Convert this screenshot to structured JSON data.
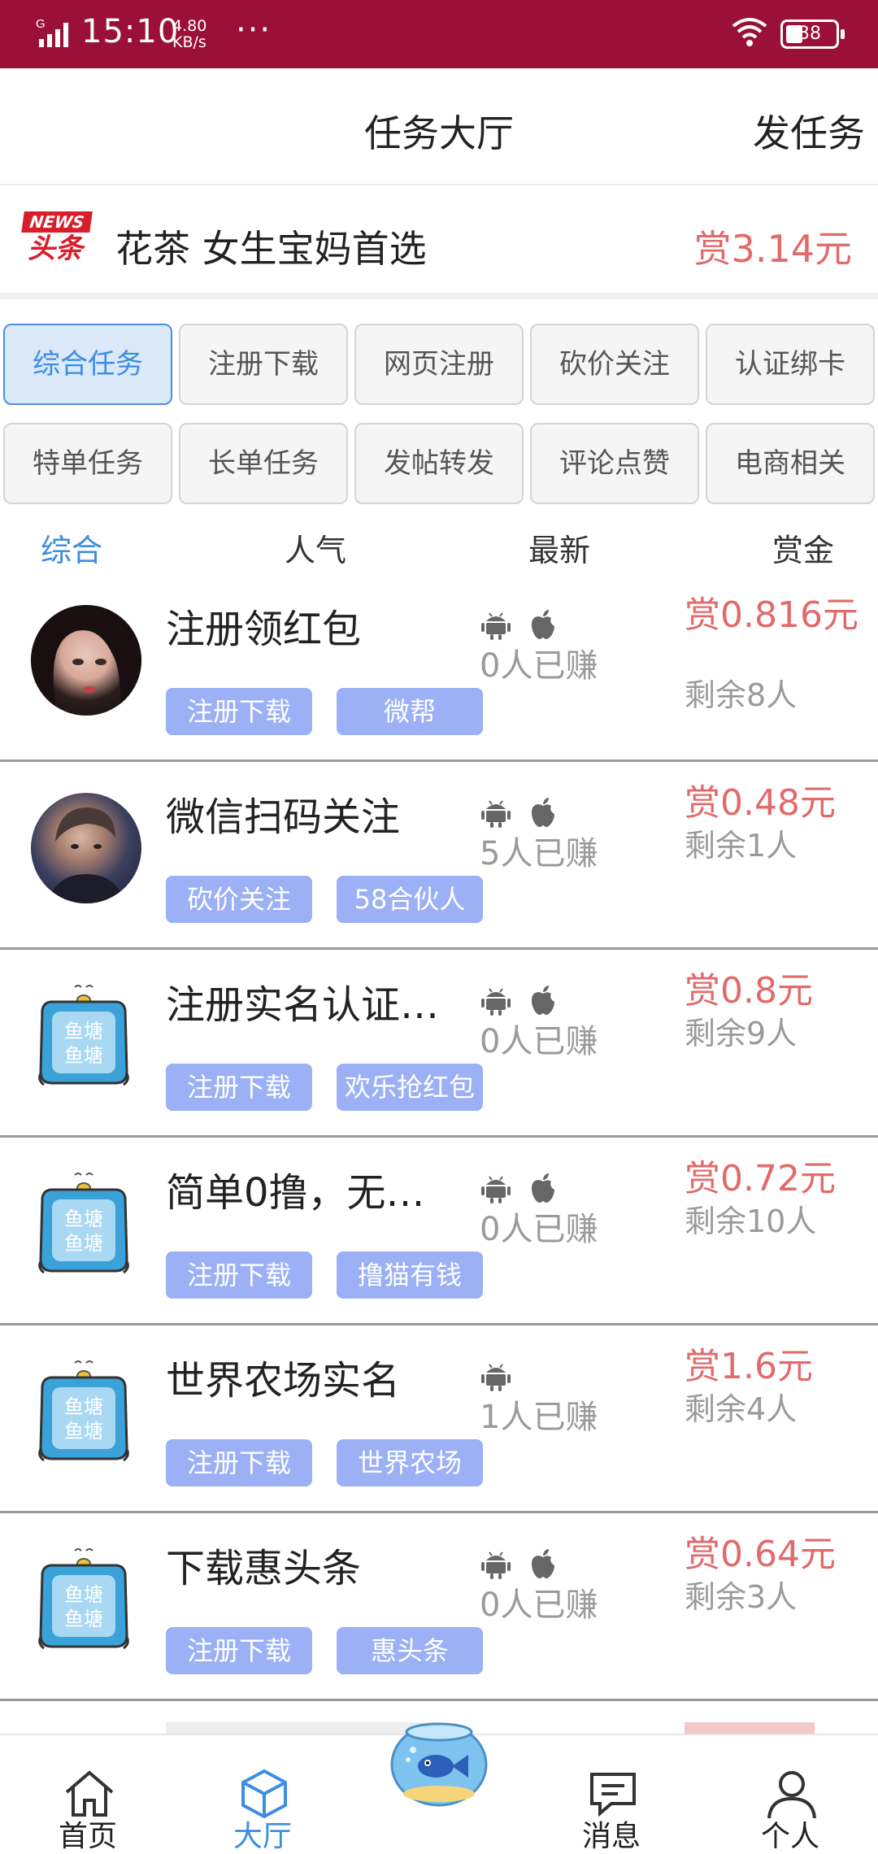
{
  "status_bar": {
    "signal": "G",
    "time": "15:10",
    "speed_value": "4.80",
    "speed_unit": "KB/s",
    "more": "···",
    "battery": "38"
  },
  "header": {
    "title": "任务大厅",
    "action": "发任务"
  },
  "banner": {
    "logo_en": "NEWS",
    "logo_cn": "头条",
    "text": "花茶 女生宝妈首选",
    "reward": "赏3.14元"
  },
  "categories": [
    "综合任务",
    "注册下载",
    "网页注册",
    "砍价关注",
    "认证绑卡",
    "特单任务",
    "长单任务",
    "发帖转发",
    "评论点赞",
    "电商相关"
  ],
  "active_category": "综合任务",
  "sort_tabs": [
    "综合",
    "人气",
    "最新",
    "赏金"
  ],
  "active_sort": "综合",
  "pond_label": "鱼塘",
  "tasks": [
    {
      "avatar": "photo-girl",
      "title": "注册领红包",
      "os": [
        "android",
        "apple"
      ],
      "earned": "0人已赚",
      "reward": "赏0.816元",
      "remaining": "剩余8人",
      "tags": [
        "注册下载",
        "微帮"
      ]
    },
    {
      "avatar": "photo-boy",
      "title": "微信扫码关注",
      "os": [
        "android",
        "apple"
      ],
      "earned": "5人已赚",
      "reward": "赏0.48元",
      "remaining": "剩余1人",
      "tags": [
        "砍价关注",
        "58合伙人"
      ]
    },
    {
      "avatar": "pond",
      "title": "注册实名认证…",
      "os": [
        "android",
        "apple"
      ],
      "earned": "0人已赚",
      "reward": "赏0.8元",
      "remaining": "剩余9人",
      "tags": [
        "注册下载",
        "欢乐抢红包"
      ]
    },
    {
      "avatar": "pond",
      "title": "简单0撸，无…",
      "os": [
        "android",
        "apple"
      ],
      "earned": "0人已赚",
      "reward": "赏0.72元",
      "remaining": "剩余10人",
      "tags": [
        "注册下载",
        "撸猫有钱"
      ]
    },
    {
      "avatar": "pond",
      "title": "世界农场实名",
      "os": [
        "android"
      ],
      "earned": "1人已赚",
      "reward": "赏1.6元",
      "remaining": "剩余4人",
      "tags": [
        "注册下载",
        "世界农场"
      ]
    },
    {
      "avatar": "pond",
      "title": "下载惠头条",
      "os": [
        "android",
        "apple"
      ],
      "earned": "0人已赚",
      "reward": "赏0.64元",
      "remaining": "剩余3人",
      "tags": [
        "注册下载",
        "惠头条"
      ]
    }
  ],
  "bottom_nav": [
    {
      "label": "首页",
      "icon": "home-icon",
      "active": false
    },
    {
      "label": "大厅",
      "icon": "cube-icon",
      "active": true
    },
    {
      "label": "",
      "icon": "fishbowl-icon",
      "active": false
    },
    {
      "label": "消息",
      "icon": "message-icon",
      "active": false
    },
    {
      "label": "个人",
      "icon": "person-icon",
      "active": false
    }
  ],
  "colors": {
    "status_bar": "#9b1036",
    "accent_blue": "#3b8ee3",
    "reward_red": "#e26a6a",
    "tag_bg": "#9bb0f5",
    "muted": "#9a9a9a"
  }
}
